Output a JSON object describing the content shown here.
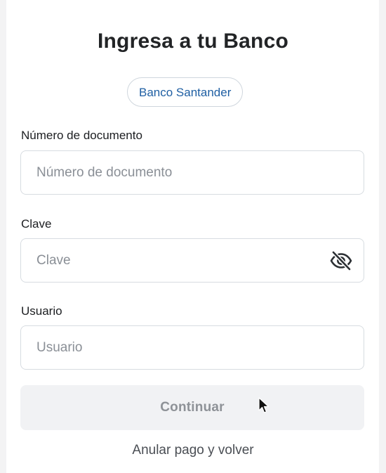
{
  "page": {
    "title": "Ingresa a tu Banco",
    "bank_chip": "Banco Santander"
  },
  "form": {
    "document": {
      "label": "Número de documento",
      "placeholder": "Número de documento",
      "value": ""
    },
    "password": {
      "label": "Clave",
      "placeholder": "Clave",
      "value": "",
      "toggle_icon": "eye-off-icon"
    },
    "user": {
      "label": "Usuario",
      "placeholder": "Usuario",
      "value": ""
    },
    "continue_label": "Continuar",
    "cancel_label": "Anular pago y volver"
  },
  "colors": {
    "chip_text": "#1f5fa3",
    "button_bg_disabled": "#f1f2f4",
    "button_text_disabled": "#8e9297"
  }
}
